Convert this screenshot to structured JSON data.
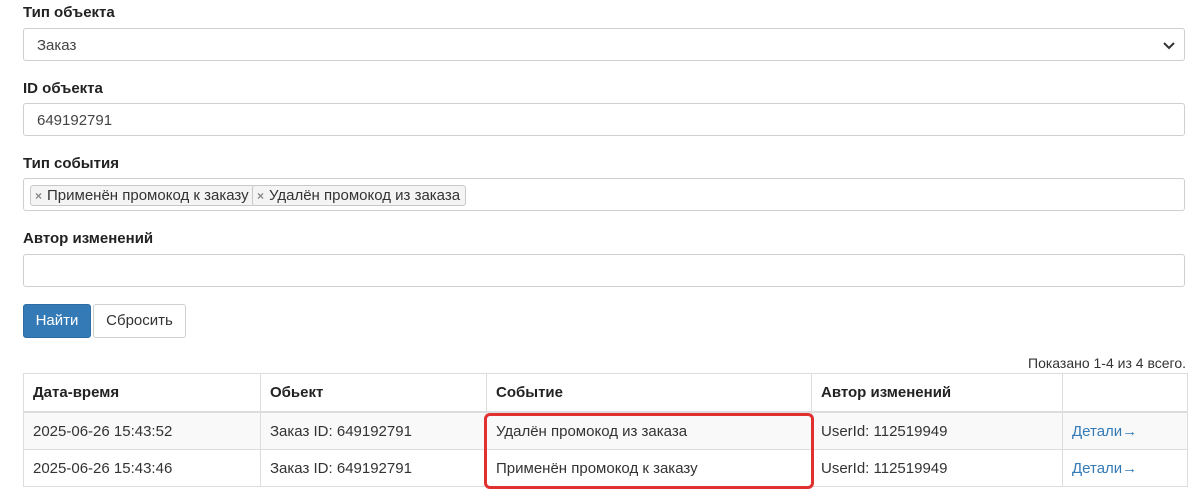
{
  "form": {
    "object_type": {
      "label": "Тип объекта",
      "value": "Заказ"
    },
    "object_id": {
      "label": "ID объекта",
      "value": "649192791"
    },
    "event_type": {
      "label": "Тип события",
      "tags": [
        "Применён промокод к заказу",
        "Удалён промокод из заказа"
      ]
    },
    "author": {
      "label": "Автор изменений",
      "value": ""
    }
  },
  "buttons": {
    "search": "Найти",
    "reset": "Сбросить"
  },
  "summary": "Показано 1-4 из 4 всего.",
  "table": {
    "headers": [
      "Дата-время",
      "Обьект",
      "Событие",
      "Автор изменений",
      ""
    ],
    "rows": [
      {
        "datetime": "2025-06-26 15:43:52",
        "object": "Заказ ID: 649192791",
        "event": "Удалён промокод из заказа",
        "author": "UserId: 112519949",
        "details": "Детали→"
      },
      {
        "datetime": "2025-06-26 15:43:46",
        "object": "Заказ ID: 649192791",
        "event": "Применён промокод к заказу",
        "author": "UserId: 112519949",
        "details": "Детали→"
      }
    ]
  },
  "colors": {
    "primary": "#337ab7",
    "highlight": "#e03030"
  }
}
